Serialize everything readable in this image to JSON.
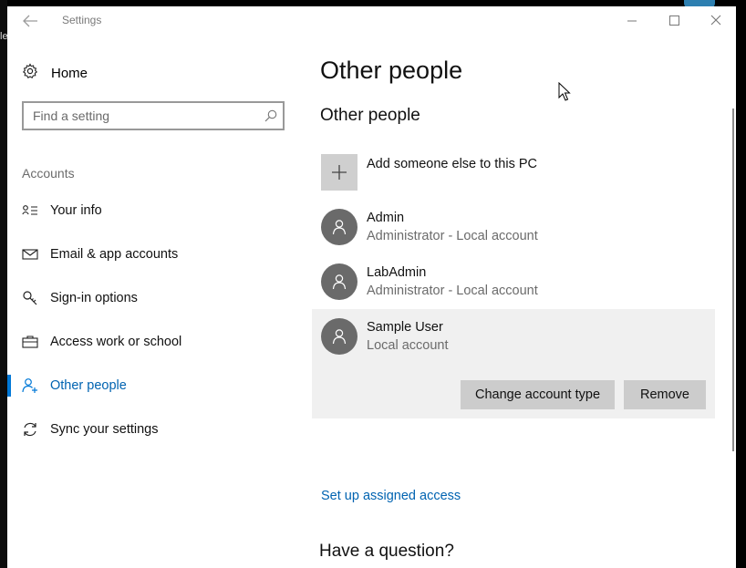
{
  "desktop": {
    "left_fragment_text": "le"
  },
  "window": {
    "title": "Settings"
  },
  "sidebar": {
    "home_label": "Home",
    "search_placeholder": "Find a setting",
    "section_header": "Accounts",
    "items": [
      {
        "label": "Your info",
        "icon": "contact-card-icon"
      },
      {
        "label": "Email & app accounts",
        "icon": "mail-icon"
      },
      {
        "label": "Sign-in options",
        "icon": "key-icon"
      },
      {
        "label": "Access work or school",
        "icon": "briefcase-icon"
      },
      {
        "label": "Other people",
        "icon": "person-add-icon",
        "active": true
      },
      {
        "label": "Sync your settings",
        "icon": "sync-icon"
      }
    ]
  },
  "main": {
    "page_title": "Other people",
    "section_title": "Other people",
    "add_label": "Add someone else to this PC",
    "users": [
      {
        "name": "Admin",
        "type": "Administrator - Local account"
      },
      {
        "name": "LabAdmin",
        "type": "Administrator - Local account"
      },
      {
        "name": "Sample User",
        "type": "Local account",
        "selected": true
      }
    ],
    "change_account_type_label": "Change account type",
    "remove_label": "Remove",
    "assigned_access_link": "Set up assigned access",
    "question_header": "Have a question?"
  },
  "colors": {
    "accent": "#0078d7",
    "link": "#0063b1",
    "selected_row": "#f0f0f0",
    "button": "#cccccc"
  }
}
